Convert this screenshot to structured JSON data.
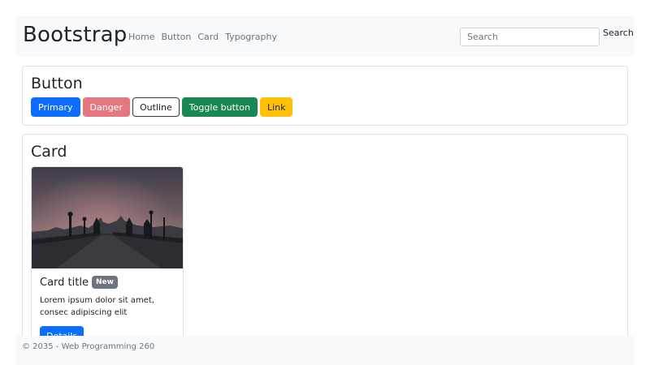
{
  "navbar": {
    "brand": "Bootstrap",
    "links": [
      "Home",
      "Button",
      "Card",
      "Typography"
    ],
    "search_placeholder": "Search",
    "search_button": "Search"
  },
  "button_section": {
    "title": "Button",
    "buttons": [
      "Primary",
      "Danger",
      "Outline",
      "Toggle button",
      "Link"
    ]
  },
  "card_section": {
    "title": "Card",
    "card": {
      "title": "Card title",
      "badge": "New",
      "text": "Lorem ipsum dolor sit amet, consec adipiscing elit",
      "button": "Details"
    }
  },
  "footer": {
    "text": "© 2035 - Web Programming 260"
  },
  "colors": {
    "primary": "#0d6efd",
    "danger": "#e4777f",
    "success": "#198754",
    "warning": "#ffc107",
    "secondary": "#6c757d",
    "light": "#f8f9fa"
  }
}
